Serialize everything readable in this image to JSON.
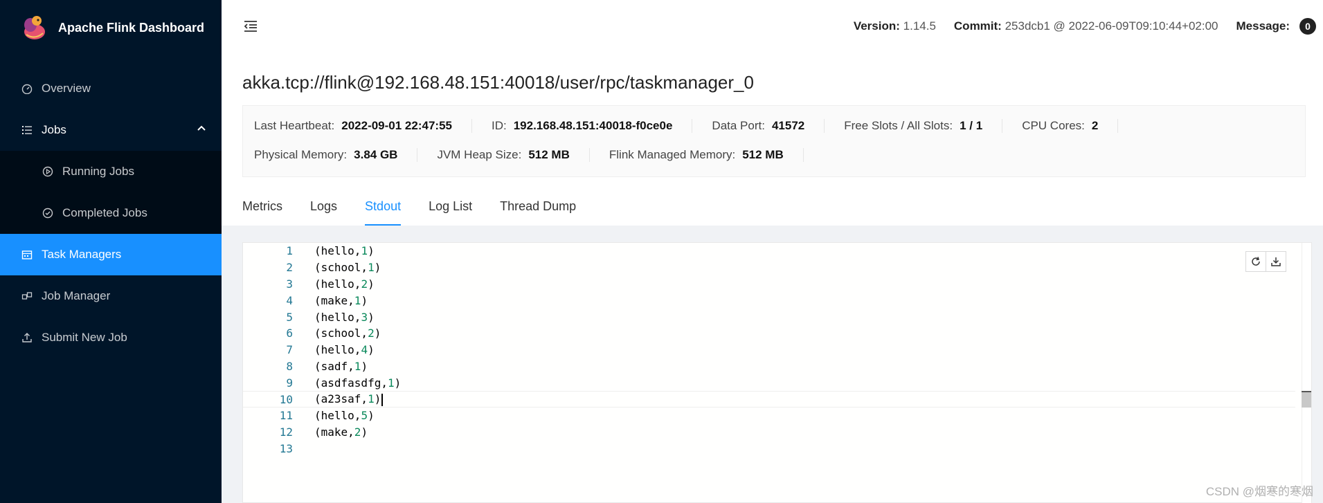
{
  "app": {
    "title": "Apache Flink Dashboard"
  },
  "sidebar": {
    "overview": "Overview",
    "jobs": "Jobs",
    "running_jobs": "Running Jobs",
    "completed_jobs": "Completed Jobs",
    "task_managers": "Task Managers",
    "job_manager": "Job Manager",
    "submit_new_job": "Submit New Job"
  },
  "header": {
    "version_label": "Version:",
    "version_value": "1.14.5",
    "commit_label": "Commit:",
    "commit_value": "253dcb1 @ 2022-06-09T09:10:44+02:00",
    "message_label": "Message:",
    "message_count": "0"
  },
  "page": {
    "title": "akka.tcp://flink@192.168.48.151:40018/user/rpc/taskmanager_0",
    "details": {
      "last_heartbeat_label": "Last Heartbeat:",
      "last_heartbeat_value": "2022-09-01 22:47:55",
      "id_label": "ID:",
      "id_value": "192.168.48.151:40018-f0ce0e",
      "data_port_label": "Data Port:",
      "data_port_value": "41572",
      "slots_label": "Free Slots / All Slots:",
      "slots_value": "1 / 1",
      "cpu_label": "CPU Cores:",
      "cpu_value": "2",
      "phys_mem_label": "Physical Memory:",
      "phys_mem_value": "3.84 GB",
      "jvm_heap_label": "JVM Heap Size:",
      "jvm_heap_value": "512 MB",
      "flink_mem_label": "Flink Managed Memory:",
      "flink_mem_value": "512 MB"
    },
    "tabs": [
      "Metrics",
      "Logs",
      "Stdout",
      "Log List",
      "Thread Dump"
    ],
    "active_tab": "Stdout"
  },
  "stdout": {
    "lines": [
      {
        "n": "1",
        "word": "(hello,",
        "num": "1",
        "end": ")"
      },
      {
        "n": "2",
        "word": "(school,",
        "num": "1",
        "end": ")"
      },
      {
        "n": "3",
        "word": "(hello,",
        "num": "2",
        "end": ")"
      },
      {
        "n": "4",
        "word": "(make,",
        "num": "1",
        "end": ")"
      },
      {
        "n": "5",
        "word": "(hello,",
        "num": "3",
        "end": ")"
      },
      {
        "n": "6",
        "word": "(school,",
        "num": "2",
        "end": ")"
      },
      {
        "n": "7",
        "word": "(hello,",
        "num": "4",
        "end": ")"
      },
      {
        "n": "8",
        "word": "(sadf,",
        "num": "1",
        "end": ")"
      },
      {
        "n": "9",
        "word": "(asdfasdfg,",
        "num": "1",
        "end": ")"
      },
      {
        "n": "10",
        "word": "(a23saf,",
        "num": "1",
        "end": ")"
      },
      {
        "n": "11",
        "word": "(hello,",
        "num": "5",
        "end": ")"
      },
      {
        "n": "12",
        "word": "(make,",
        "num": "2",
        "end": ")"
      },
      {
        "n": "13",
        "word": "",
        "num": "",
        "end": ""
      }
    ],
    "current_line": "10"
  },
  "watermark": "CSDN @烟寒的寒烟",
  "colors": {
    "sidebar_bg": "#001529",
    "active_blue": "#1890ff",
    "line_number": "#237893",
    "code_number": "#09885a"
  }
}
